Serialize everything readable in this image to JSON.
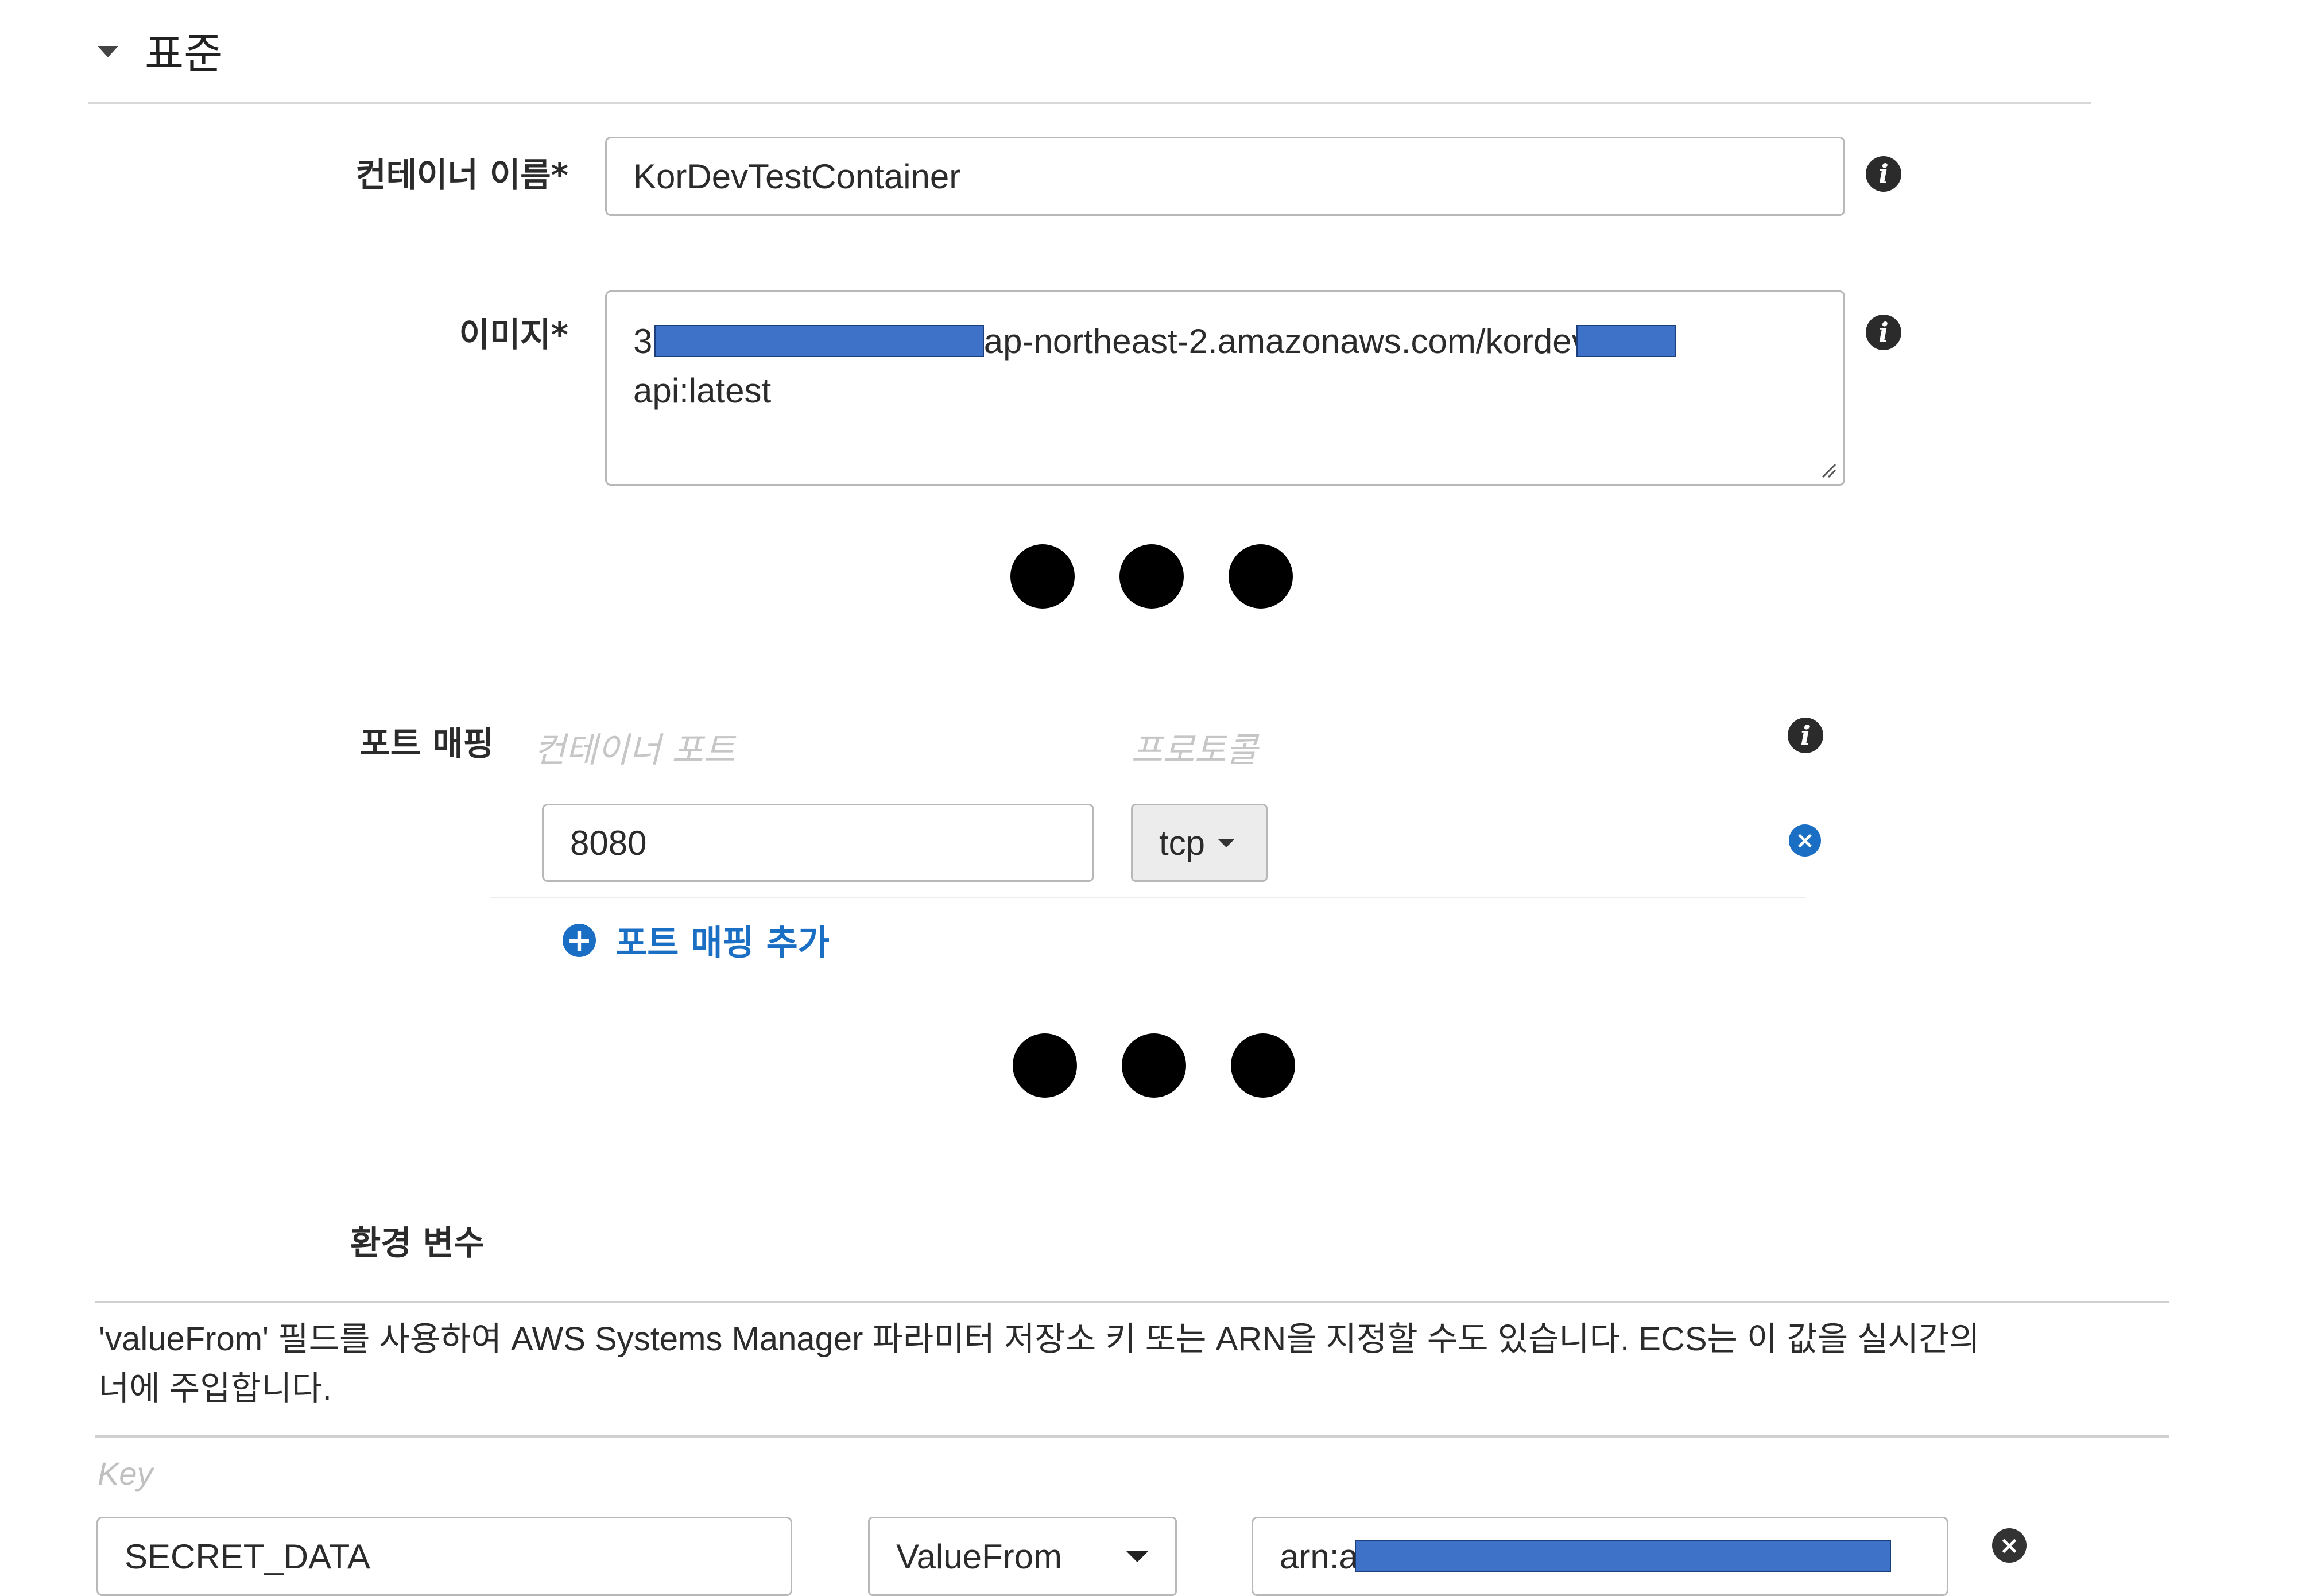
{
  "section": {
    "title": "표준"
  },
  "container_name": {
    "label": "컨테이너 이름*",
    "value": "KorDevTestContainer"
  },
  "image": {
    "label": "이미지*",
    "line1_prefix": "31",
    "line1_middle": "ap-northeast-2.amazonaws.com/kordev",
    "line2": "api:latest"
  },
  "port_mapping": {
    "label": "포트 매핑",
    "container_port_header": "컨테이너 포트",
    "protocol_header": "프로토콜",
    "container_port_value": "8080",
    "protocol_value": "tcp",
    "add_label": "포트 매핑 추가"
  },
  "env": {
    "label": "환경 변수",
    "description_line1": "'valueFrom' 필드를 사용하여 AWS Systems Manager 파라미터 저장소 키 또는 ARN을 지정할 수도 있습니다. ECS는 이 값을 실시간의",
    "description_line2": "너에 주입합니다.",
    "key_header": "Key",
    "key_value": "SECRET_DATA",
    "type_value": "ValueFrom",
    "value_prefix": "arn:a"
  },
  "icons": {
    "info": "info-icon",
    "remove": "remove-icon",
    "add": "plus-circle-icon",
    "collapse": "caret-down-icon"
  },
  "colors": {
    "link": "#1a6fc4",
    "redaction": "#3d72c8"
  }
}
